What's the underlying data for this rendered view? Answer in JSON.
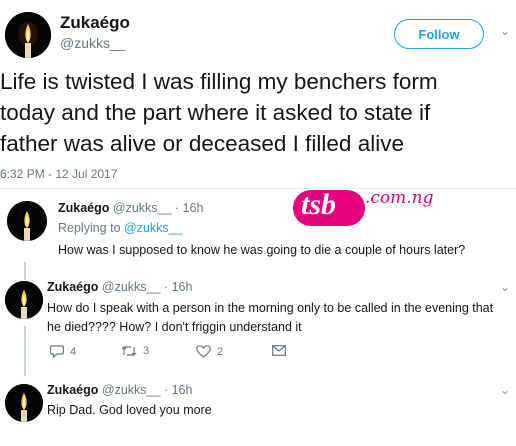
{
  "main_tweet": {
    "name": "Zukaégo",
    "handle": "@zukks__",
    "follow_label": "Follow",
    "text_lines": [
      "Life is twisted I was filling my benchers form",
      "today and the part where it asked to state if",
      "father was alive or deceased I filled alive"
    ],
    "timestamp": "6:32 PM - 12 Jul 2017"
  },
  "watermark": {
    "brand": "tsb",
    "domain": ".com.ng"
  },
  "replies": [
    {
      "name": "Zukaégo",
      "handle": "@zukks__",
      "sep": "·",
      "time": "16h",
      "replying_prefix": "Replying to",
      "replying_to": "@zukks__",
      "text": "How was I supposed to know he was going to die a couple of hours later?"
    },
    {
      "name": "Zukaégo",
      "handle": "@zukks__",
      "sep": "·",
      "time": "16h",
      "text_lines": [
        "How do I speak with a person in the morning only to be called in the evening that",
        "he died???? How?  I don't friggin understand it"
      ],
      "actions": {
        "replies": "4",
        "retweets": "3",
        "likes": "2"
      }
    },
    {
      "name": "Zukaégo",
      "handle": "@zukks__",
      "sep": "·",
      "time": "16h",
      "text": "Rip Dad.  God loved you more"
    }
  ],
  "colors": {
    "accent": "#1da1f2",
    "watermark": "#e6007e",
    "muted": "#657786"
  }
}
